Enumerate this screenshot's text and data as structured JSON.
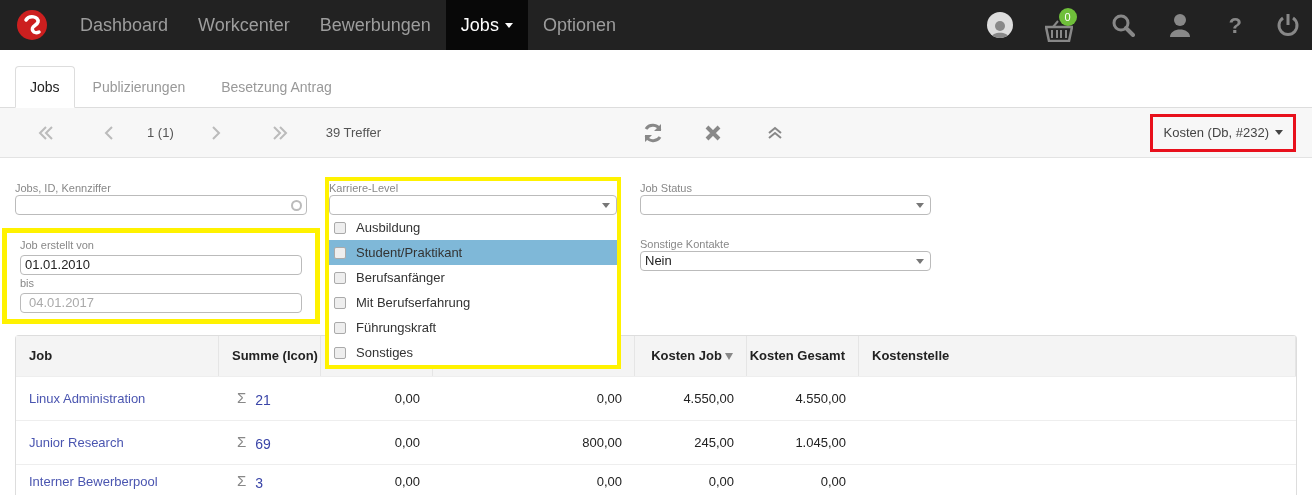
{
  "navbar": {
    "items": [
      {
        "label": "Dashboard",
        "selected": false,
        "has_menu": false
      },
      {
        "label": "Workcenter",
        "selected": false,
        "has_menu": false
      },
      {
        "label": "Bewerbungen",
        "selected": false,
        "has_menu": false
      },
      {
        "label": "Jobs",
        "selected": true,
        "has_menu": true
      },
      {
        "label": "Optionen",
        "selected": false,
        "has_menu": false
      }
    ],
    "cart_count": "0",
    "help_glyph": "?"
  },
  "tabs": [
    {
      "label": "Jobs",
      "selected": true
    },
    {
      "label": "Publizierungen",
      "selected": false
    },
    {
      "label": "Besetzung Antrag",
      "selected": false
    }
  ],
  "toolbar": {
    "page": "1 (1)",
    "hits": "39 Treffer",
    "view_selector": {
      "label": "Kosten (Db, #232)",
      "highlighted": true
    }
  },
  "filters": {
    "search": {
      "label": "Jobs, ID, Kennziffer"
    },
    "date_range": {
      "label": "Job erstellt von",
      "from": "01.01.2010",
      "to_label": "bis",
      "to_placeholder": "04.01.2017",
      "highlighted": true
    },
    "career_level": {
      "label": "Karriere-Level",
      "expanded": true,
      "highlighted": true,
      "options": [
        {
          "label": "Ausbildung",
          "checked": false,
          "hovered": false
        },
        {
          "label": "Student/Praktikant",
          "checked": false,
          "hovered": true
        },
        {
          "label": "Berufsanfänger",
          "checked": false,
          "hovered": false
        },
        {
          "label": "Mit Berufserfahrung",
          "checked": false,
          "hovered": false
        },
        {
          "label": "Führungskraft",
          "checked": false,
          "hovered": false
        },
        {
          "label": "Sonstiges",
          "checked": false,
          "hovered": false
        }
      ]
    },
    "job_status": {
      "label": "Job Status"
    },
    "other_contacts": {
      "label": "Sonstige Kontakte",
      "value": "Nein"
    }
  },
  "table": {
    "columns": [
      {
        "label": "Job"
      },
      {
        "label": "Summe (Icon)"
      },
      {},
      {},
      {
        "label": "Kosten Job",
        "sorted_descending": true
      },
      {
        "label": "Kosten Gesamt"
      },
      {
        "label": "Kostenstelle"
      }
    ],
    "rows": [
      {
        "job": "Linux Administration",
        "sum_glyph": "Σ",
        "sum": "21",
        "column_3": "0,00",
        "column_4": "0,00",
        "kosten_job": "4.550,00",
        "kosten_gesamt": "4.550,00"
      },
      {
        "job": "Junior Research",
        "sum_glyph": "Σ",
        "sum": "69",
        "column_3": "0,00",
        "column_4": "800,00",
        "kosten_job": "245,00",
        "kosten_gesamt": "1.045,00"
      },
      {
        "job": "Interner Bewerberpool",
        "sum_glyph": "Σ",
        "sum": "3",
        "column_3": "0,00",
        "column_4": "0,00",
        "kosten_job": "0,00",
        "kosten_gesamt": "0,00"
      }
    ]
  }
}
